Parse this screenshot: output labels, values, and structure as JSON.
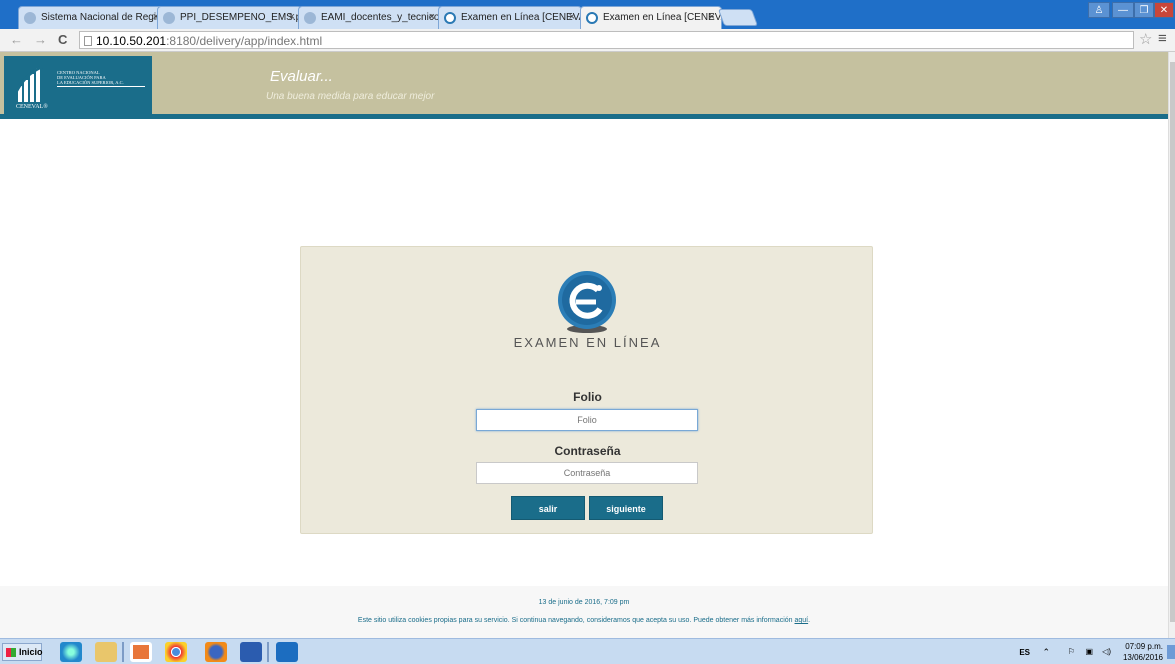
{
  "browser": {
    "tabs": [
      {
        "title": "Sistema Nacional de Registr"
      },
      {
        "title": "PPI_DESEMPENO_EMS.pdf"
      },
      {
        "title": "EAMI_docentes_y_tecnico_d"
      },
      {
        "title": "Examen en Línea [CENEVAL"
      },
      {
        "title": "Examen en Línea [CENEVAL"
      }
    ],
    "tab_close": "×",
    "url_host": "10.10.50.201",
    "url_rest": ":8180/delivery/app/index.html",
    "back": "←",
    "forward": "→",
    "reload": "C",
    "star": "☆",
    "menu": "≡",
    "window_buttons": [
      "♙",
      "—",
      "❐",
      "✕"
    ]
  },
  "banner": {
    "logo_lines": [
      "CENTRO NACIONAL",
      "DE EVALUACIÓN PARA",
      "LA EDUCACIÓN SUPERIOR, A.C."
    ],
    "logo_brand": "CENEVAL®",
    "slogan": "Evaluar...",
    "tagline": "Una buena medida para educar mejor",
    "color_banner": "#c5c19f",
    "color_accent": "#1a6d8a"
  },
  "login": {
    "product_name": "EXAMEN EN LÍNEA",
    "folio_label": "Folio",
    "folio_placeholder": "Folio",
    "password_label": "Contraseña",
    "password_placeholder": "Contraseña",
    "exit_button": "salir",
    "next_button": "siguiente"
  },
  "footer": {
    "date": "13 de junio de 2016, 7:09 pm",
    "cookie_text": "Este sitio utiliza cookies propias para su servicio. Si continua navegando, consideramos que acepta su uso. Puede obtener más información ",
    "cookie_link": "aquí",
    "cookie_end": "."
  },
  "taskbar": {
    "start_label": "Inicio",
    "language": "ES",
    "time": "07:09 p.m.",
    "date": "13/06/2016",
    "icons": [
      "ie-icon",
      "explorer-icon",
      "media-icon",
      "chrome-icon",
      "firefox-icon",
      "word-icon",
      "outlook-icon"
    ]
  }
}
